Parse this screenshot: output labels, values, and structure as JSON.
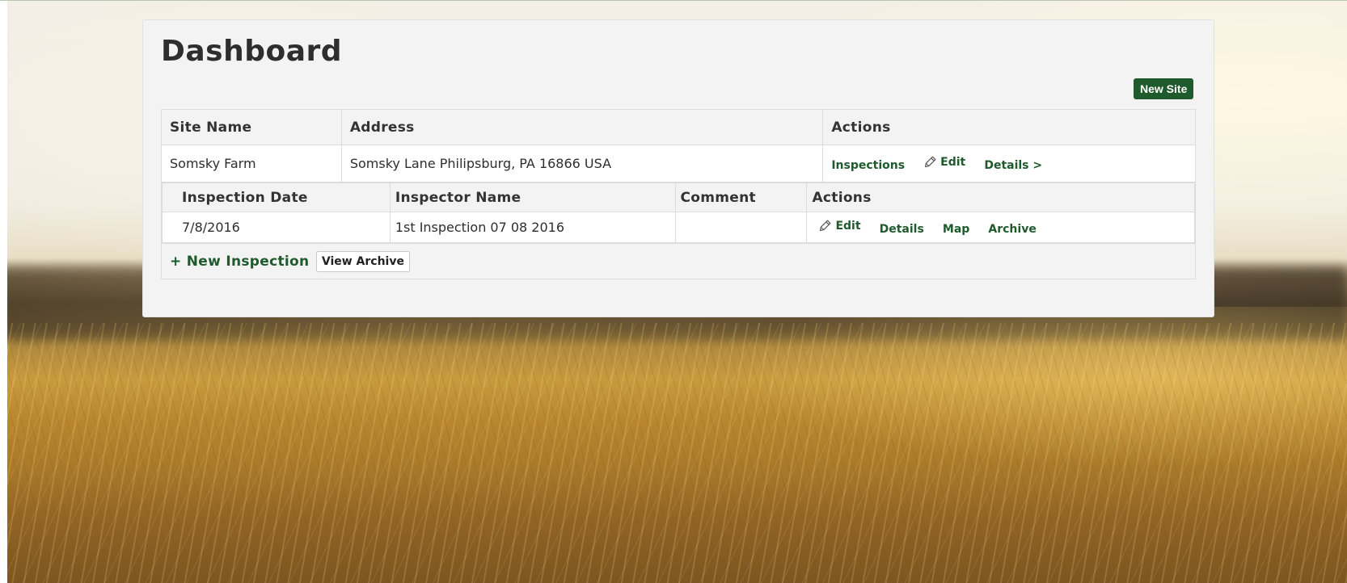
{
  "page": {
    "title": "Dashboard",
    "new_site_label": "New Site"
  },
  "sites_table": {
    "headers": [
      "Site Name",
      "Address",
      "Actions"
    ],
    "rows": [
      {
        "site_name": "Somsky Farm",
        "address": "Somsky Lane Philipsburg, PA 16866 USA",
        "actions": {
          "inspections": "Inspections",
          "edit": "Edit",
          "details": "Details >"
        }
      }
    ]
  },
  "inspections_table": {
    "headers": [
      "Inspection Date",
      "Inspector Name",
      "Comment",
      "Actions"
    ],
    "rows": [
      {
        "date": "7/8/2016",
        "inspector": "1st Inspection 07 08 2016",
        "comment": "",
        "actions": {
          "edit": "Edit",
          "details": "Details",
          "map": "Map",
          "archive": "Archive"
        }
      }
    ],
    "new_inspection_label": "+ New Inspection",
    "view_archive_label": "View Archive"
  },
  "icons": {
    "edit": "pencil-icon"
  },
  "colors": {
    "accent_green": "#1f5a2c",
    "panel_bg": "#f3f3f3"
  }
}
